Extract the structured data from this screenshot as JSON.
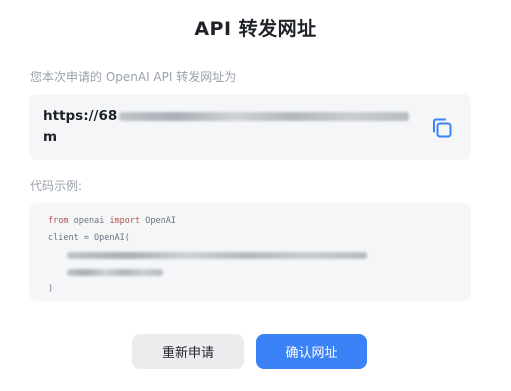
{
  "dialog": {
    "title": "API 转发网址",
    "url_label": "您本次申请的 OpenAI API 转发网址为",
    "url_visible_prefix": "https://68",
    "url_visible_suffix": "m",
    "copy_icon": "copy-icon",
    "code_label": "代码示例:",
    "code": {
      "line1_kw1": "from",
      "line1_mod": " openai ",
      "line1_kw2": "import",
      "line1_cls": " OpenAI",
      "line2": "client = OpenAI(",
      "line5": ")"
    },
    "buttons": {
      "reapply": "重新申请",
      "confirm": "确认网址"
    }
  },
  "colors": {
    "accent": "#3b82f6",
    "keyword": "#b5504f",
    "box_bg": "#f4f6f8"
  }
}
